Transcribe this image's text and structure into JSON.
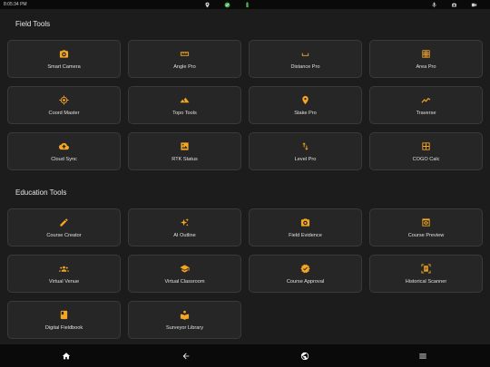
{
  "status_bar": {
    "time": "8:05:34 PM"
  },
  "accent_color": "#f5a623",
  "sections": [
    {
      "title": "Field Tools",
      "tiles": [
        {
          "label": "Smart Camera",
          "icon": "camera-icon"
        },
        {
          "label": "Angle Pro",
          "icon": "ruler-icon"
        },
        {
          "label": "Distance Pro",
          "icon": "measure-bracket-icon"
        },
        {
          "label": "Area Pro",
          "icon": "grid-icon"
        },
        {
          "label": "Coord Master",
          "icon": "crosshair-icon"
        },
        {
          "label": "Topo Tools",
          "icon": "terrain-icon"
        },
        {
          "label": "Stake Pro",
          "icon": "location-pin-icon"
        },
        {
          "label": "Traverse",
          "icon": "trend-line-icon"
        },
        {
          "label": "Cloud Sync",
          "icon": "cloud-upload-icon"
        },
        {
          "label": "RTK Status",
          "icon": "image-icon"
        },
        {
          "label": "Level Pro",
          "icon": "swap-vertical-icon"
        },
        {
          "label": "COGO Calc",
          "icon": "calculator-icon"
        }
      ]
    },
    {
      "title": "Education Tools",
      "tiles": [
        {
          "label": "Course Creator",
          "icon": "pencil-icon"
        },
        {
          "label": "AI Outline",
          "icon": "sparkle-icon"
        },
        {
          "label": "Field Evidence",
          "icon": "camera-icon"
        },
        {
          "label": "Course Preview",
          "icon": "preview-icon"
        },
        {
          "label": "Virtual Venue",
          "icon": "group-icon"
        },
        {
          "label": "Virtual Classroom",
          "icon": "graduation-cap-icon"
        },
        {
          "label": "Course Approval",
          "icon": "verified-badge-icon"
        },
        {
          "label": "Historical Scanner",
          "icon": "document-scanner-icon"
        },
        {
          "label": "Digital Fieldbook",
          "icon": "book-icon"
        },
        {
          "label": "Surveyor Library",
          "icon": "reading-icon"
        }
      ]
    }
  ]
}
